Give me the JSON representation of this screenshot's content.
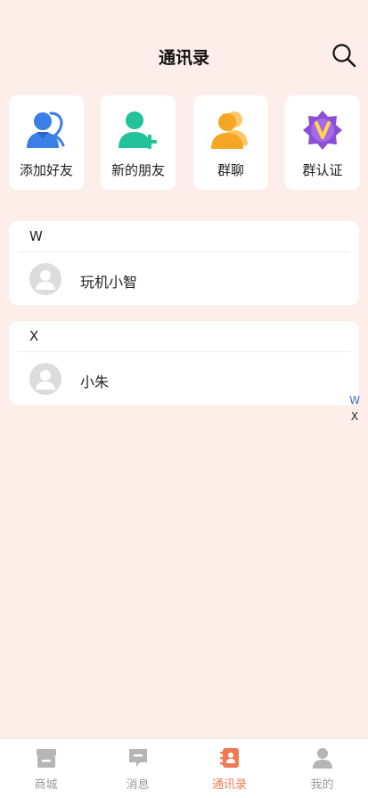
{
  "header": {
    "title": "通讯录",
    "search_icon": "search-icon"
  },
  "actions": [
    {
      "label": "添加好友",
      "icon": "add-friend-icon"
    },
    {
      "label": "新的朋友",
      "icon": "new-friend-icon"
    },
    {
      "label": "群聊",
      "icon": "group-chat-icon"
    },
    {
      "label": "群认证",
      "icon": "group-verify-icon"
    }
  ],
  "groups": [
    {
      "letter": "W",
      "contacts": [
        {
          "name": "玩机小智"
        }
      ]
    },
    {
      "letter": "X",
      "contacts": [
        {
          "name": "小朱"
        }
      ]
    }
  ],
  "index": [
    "W",
    "X"
  ],
  "tabs": [
    {
      "label": "商城",
      "icon": "store-icon",
      "active": false
    },
    {
      "label": "消息",
      "icon": "message-icon",
      "active": false
    },
    {
      "label": "通讯录",
      "icon": "contacts-icon",
      "active": true
    },
    {
      "label": "我的",
      "icon": "profile-icon",
      "active": false
    }
  ],
  "colors": {
    "background": "#fdeee9",
    "active_tab": "#f07a55",
    "index_w": "#3b6fc6",
    "index_x": "#222222",
    "icon_blue": "#3a7fe6",
    "icon_teal": "#22c39a",
    "icon_orange": "#f5a623",
    "icon_purple": "#8a4fd6"
  }
}
